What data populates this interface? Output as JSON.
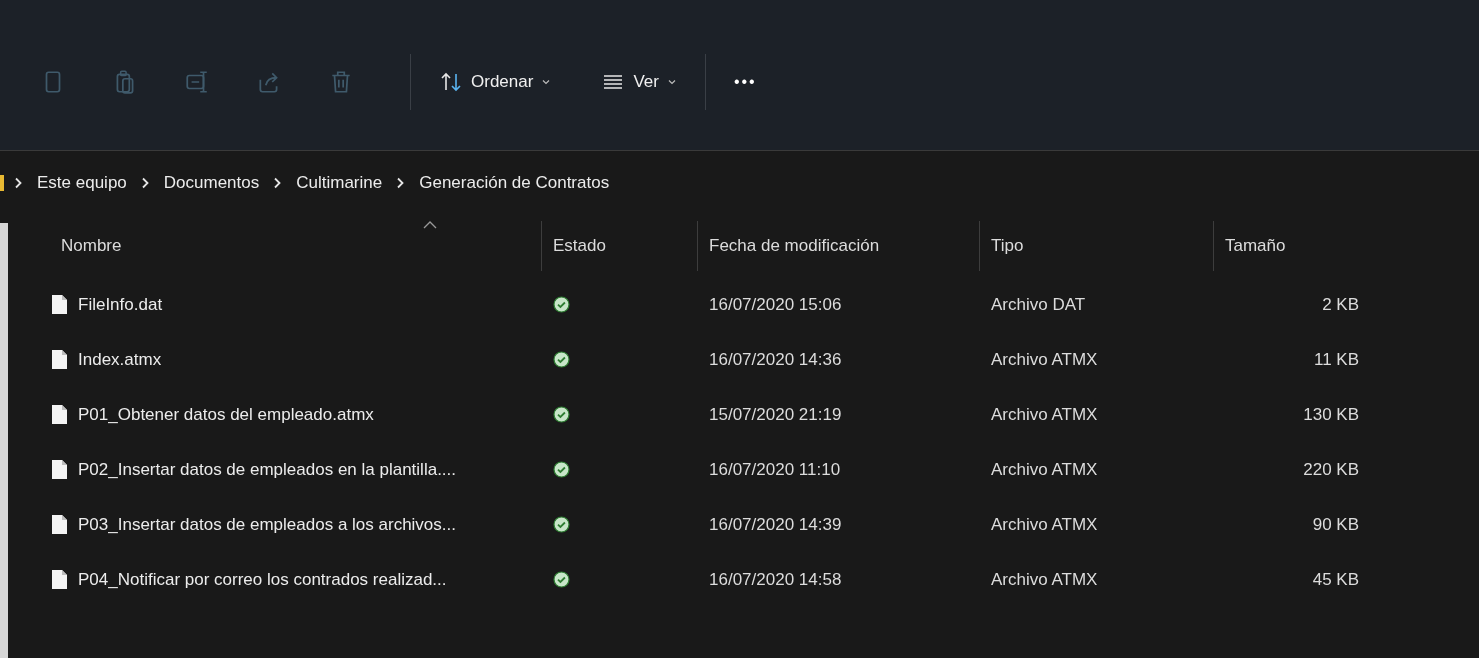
{
  "toolbar": {
    "icon_buttons": [
      {
        "kind": "copy",
        "disabled": true
      },
      {
        "kind": "paste",
        "disabled": true
      },
      {
        "kind": "rename",
        "disabled": true
      },
      {
        "kind": "share",
        "disabled": true
      },
      {
        "kind": "delete",
        "disabled": true
      }
    ],
    "menus": [
      {
        "kind": "sort",
        "label": "Ordenar"
      },
      {
        "kind": "view",
        "label": "Ver"
      }
    ],
    "more": "•••"
  },
  "breadcrumb": [
    "Este equipo",
    "Documentos",
    "Cultimarine",
    "Generación de Contratos"
  ],
  "table": {
    "columns": [
      {
        "label": "Nombre",
        "sorted": true
      },
      {
        "label": "Estado",
        "sorted": false
      },
      {
        "label": "Fecha de modificación",
        "sorted": false
      },
      {
        "label": "Tipo",
        "sorted": false
      },
      {
        "label": "Tamaño",
        "sorted": false
      }
    ],
    "rows": [
      {
        "name": "FileInfo.dat",
        "synced": true,
        "modified": "16/07/2020 15:06",
        "type": "Archivo DAT",
        "size": "2 KB"
      },
      {
        "name": "Index.atmx",
        "synced": true,
        "modified": "16/07/2020 14:36",
        "type": "Archivo ATMX",
        "size": "11 KB"
      },
      {
        "name": "P01_Obtener datos del empleado.atmx",
        "synced": true,
        "modified": "15/07/2020 21:19",
        "type": "Archivo ATMX",
        "size": "130 KB"
      },
      {
        "name": "P02_Insertar datos de empleados en la plantilla....",
        "synced": true,
        "modified": "16/07/2020 11:10",
        "type": "Archivo ATMX",
        "size": "220 KB"
      },
      {
        "name": "P03_Insertar datos de empleados a los archivos...",
        "synced": true,
        "modified": "16/07/2020 14:39",
        "type": "Archivo ATMX",
        "size": "90 KB"
      },
      {
        "name": "P04_Notificar por correo los contrados realizad...",
        "synced": true,
        "modified": "16/07/2020 14:58",
        "type": "Archivo ATMX",
        "size": "45 KB"
      }
    ]
  }
}
